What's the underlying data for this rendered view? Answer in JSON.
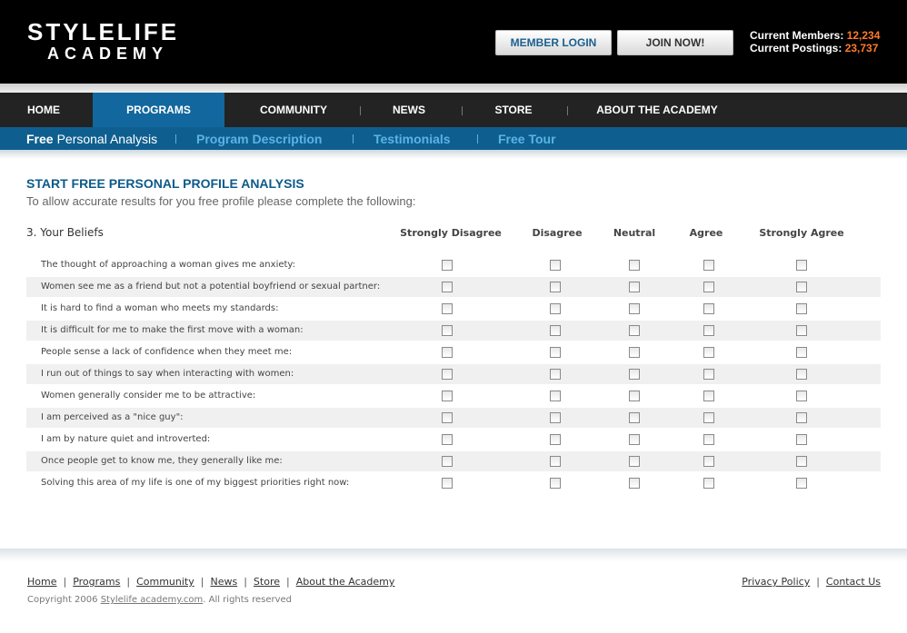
{
  "logo": {
    "line1": "STYLELIFE",
    "line2": "ACADEMY"
  },
  "header": {
    "login_label": "MEMBER  LOGIN",
    "join_label": "JOIN NOW!",
    "members_label": "Current Members:",
    "members_value": "12,234",
    "postings_label": "Current Postings:",
    "postings_value": "23,737",
    "accent_color": "#ff7a2a"
  },
  "nav": {
    "items": [
      {
        "label": "HOME"
      },
      {
        "label": "PROGRAMS"
      },
      {
        "label": "COMMUNITY"
      },
      {
        "label": "NEWS"
      },
      {
        "label": "STORE"
      },
      {
        "label": "ABOUT THE ACADEMY"
      }
    ],
    "active": "PROGRAMS",
    "active_color": "#12679e"
  },
  "subnav": {
    "active_bold": "Free",
    "active_rest": "Personal Analysis",
    "items": [
      {
        "label": "Program Description"
      },
      {
        "label": "Testimonials"
      },
      {
        "label": "Free Tour"
      }
    ]
  },
  "page": {
    "title": "START FREE PERSONAL PROFILE ANALYSIS",
    "intro": "To allow accurate results for you free profile please complete the following:",
    "section": "3. Your Beliefs"
  },
  "columns": [
    "Strongly Disagree",
    "Disagree",
    "Neutral",
    "Agree",
    "Strongly Agree"
  ],
  "questions": [
    "The thought of approaching a woman gives me anxiety:",
    "Women see me as a friend but not a potential boyfriend or sexual partner:",
    "It is hard to find a woman who meets my standards:",
    "It is difficult for me to make the first move with a woman:",
    "People sense a lack of confidence when they meet me:",
    "I run out of things to say when interacting with women:",
    "Women generally consider me to be attractive:",
    "I am perceived as a \"nice guy\":",
    "I am by nature quiet and introverted:",
    "Once people get to know me, they generally like me:",
    "Solving this area of my life is one of my biggest priorities right now:"
  ],
  "footer": {
    "links": [
      {
        "label": "Home"
      },
      {
        "label": "Programs"
      },
      {
        "label": "Community"
      },
      {
        "label": "News"
      },
      {
        "label": "Store"
      },
      {
        "label": "About the Academy"
      }
    ],
    "right_links": [
      {
        "label": "Privacy Policy"
      },
      {
        "label": "Contact Us"
      }
    ],
    "copyright_prefix": "Copyright 2006",
    "copyright_link": "Stylelife academy.com",
    "copyright_suffix": ".  All rights reserved"
  }
}
